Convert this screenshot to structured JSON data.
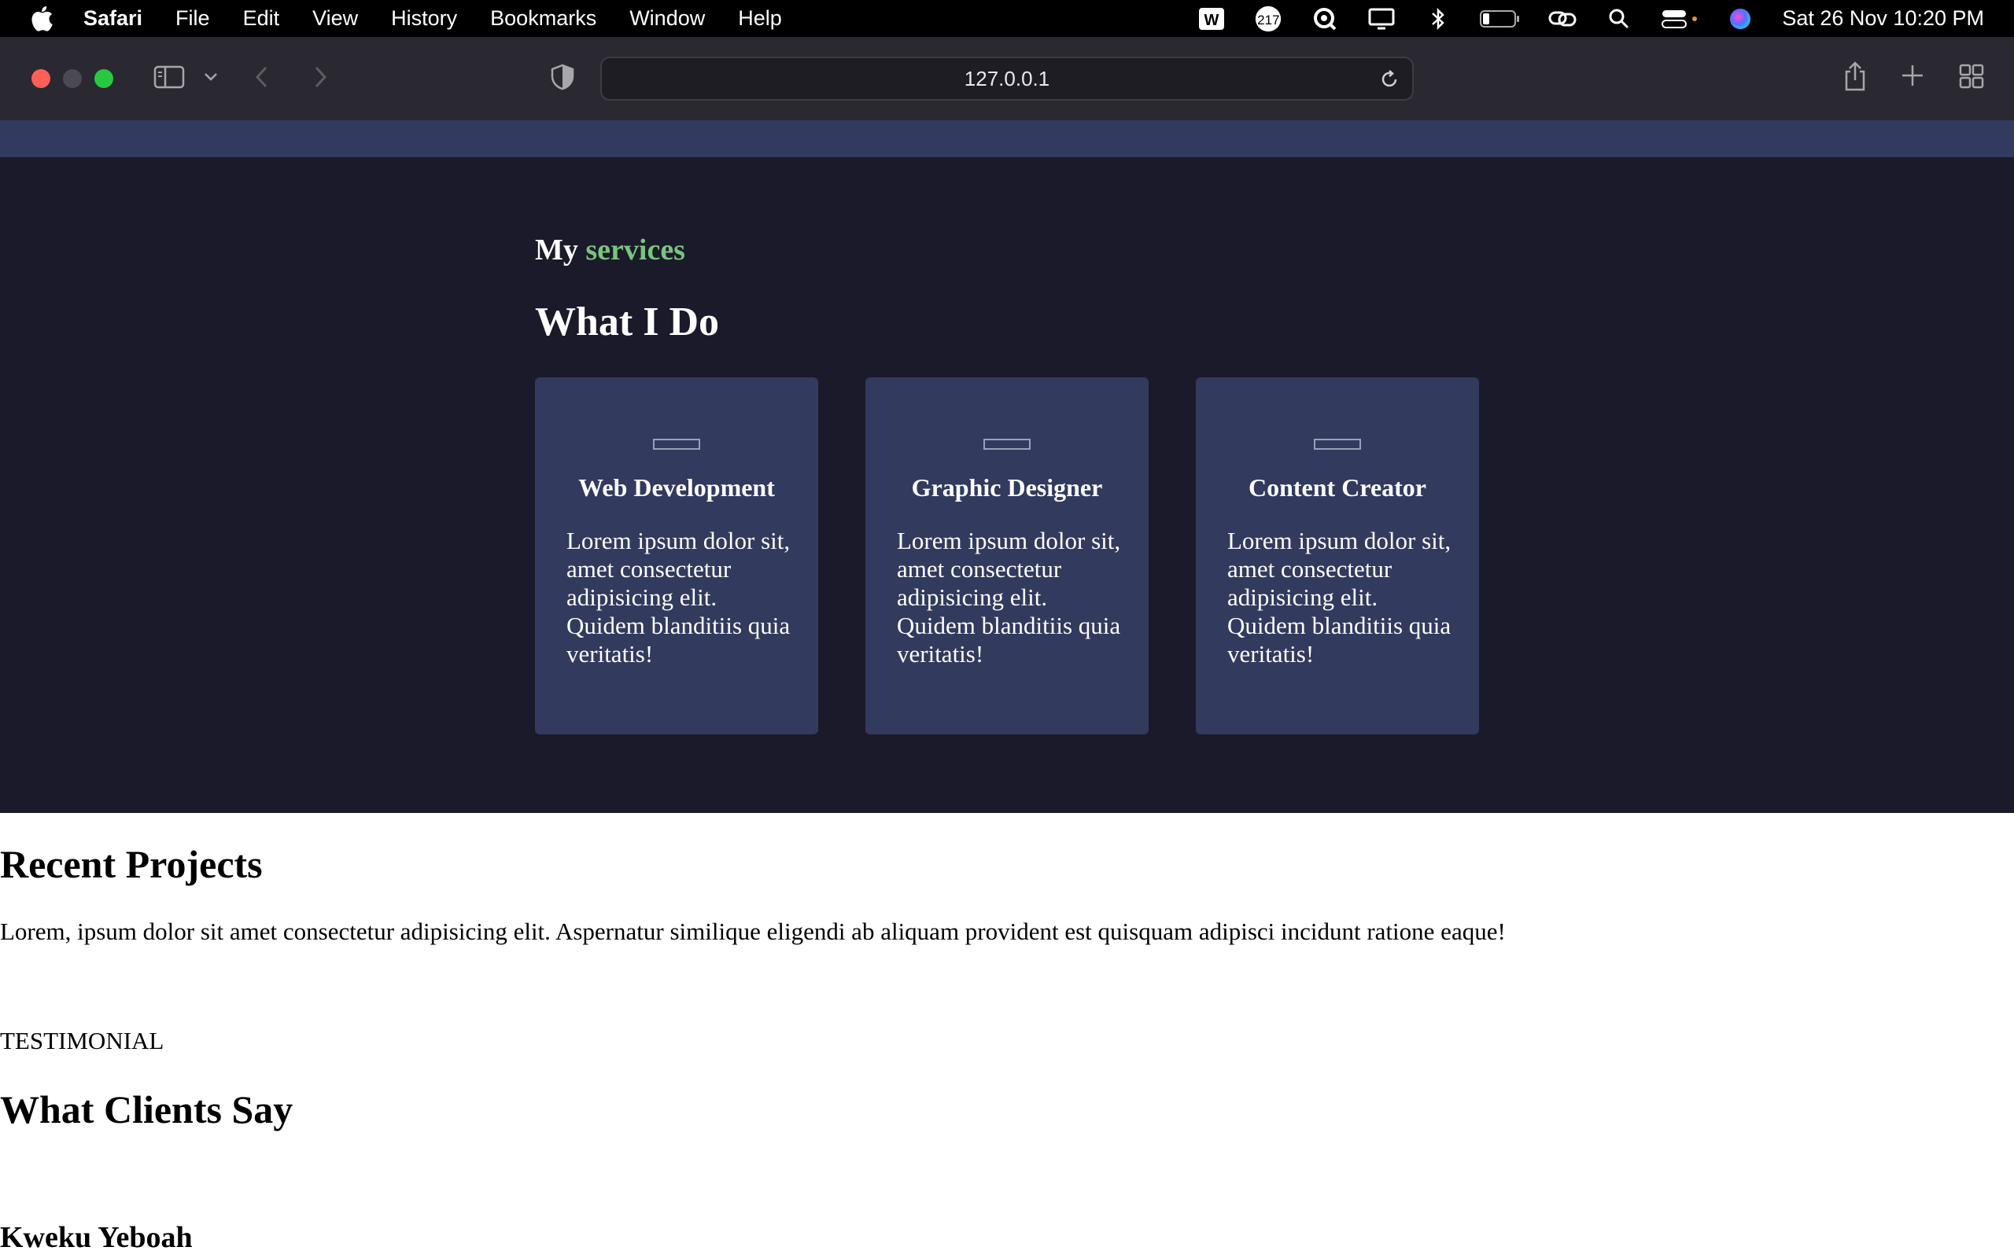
{
  "menubar": {
    "app_name": "Safari",
    "items": [
      "File",
      "Edit",
      "View",
      "History",
      "Bookmarks",
      "Window",
      "Help"
    ],
    "notification_count": "217",
    "clock": "Sat 26 Nov  10:20 PM"
  },
  "browser": {
    "url": "127.0.0.1"
  },
  "services": {
    "subtitle_prefix": "My",
    "subtitle_accent": "services",
    "heading": "What I Do",
    "accent_color": "#7ac47f",
    "cards": [
      {
        "title": "Web Development",
        "description": "Lorem ipsum dolor sit, amet consectetur adipisicing elit. Quidem blanditiis quia veritatis!"
      },
      {
        "title": "Graphic Designer",
        "description": "Lorem ipsum dolor sit, amet consectetur adipisicing elit. Quidem blanditiis quia veritatis!"
      },
      {
        "title": "Content Creator",
        "description": "Lorem ipsum dolor sit, amet consectetur adipisicing elit. Quidem blanditiis quia veritatis!"
      }
    ]
  },
  "projects": {
    "title": "Recent Projects",
    "text": "Lorem, ipsum dolor sit amet consectetur adipisicing elit. Aspernatur similique eligendi ab aliquam provident est quisquam adipisci incidunt ratione eaque!"
  },
  "testimonial": {
    "label": "TESTIMONIAL",
    "title": "What Clients Say",
    "client_name": "Kweku Yeboah"
  }
}
